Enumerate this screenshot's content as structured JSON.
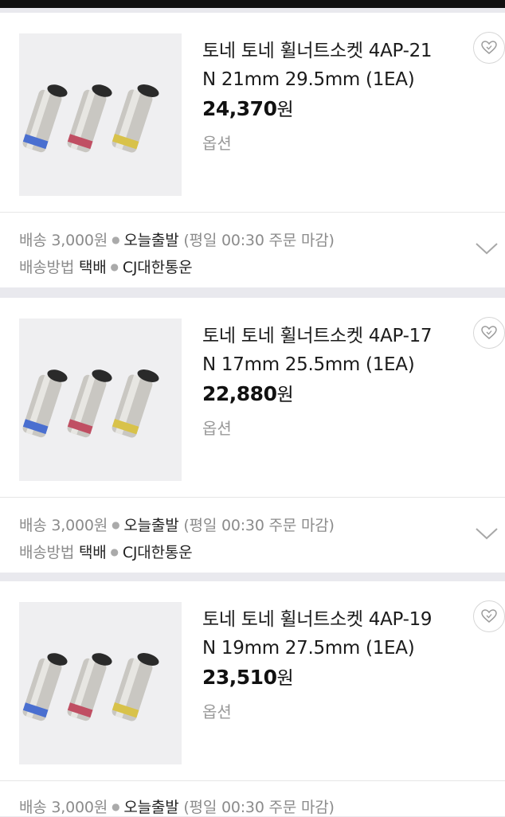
{
  "products": [
    {
      "title_line1": "토네 토네 휠너트소켓 4AP-21",
      "title_line2": "N 21mm 29.5mm (1EA)",
      "price": "24,370",
      "currency": "원",
      "option_label": "옵션",
      "shipping": {
        "fee_label": "배송",
        "fee": "3,000원",
        "dispatch": "오늘출발",
        "cutoff": "(평일 00:30 주문 마감)",
        "method_label": "배송방법",
        "method": "택배",
        "carrier": "CJ대한통운"
      }
    },
    {
      "title_line1": "토네 토네 휠너트소켓 4AP-17",
      "title_line2": "N 17mm 25.5mm (1EA)",
      "price": "22,880",
      "currency": "원",
      "option_label": "옵션",
      "shipping": {
        "fee_label": "배송",
        "fee": "3,000원",
        "dispatch": "오늘출발",
        "cutoff": "(평일 00:30 주문 마감)",
        "method_label": "배송방법",
        "method": "택배",
        "carrier": "CJ대한통운"
      }
    },
    {
      "title_line1": "토네 토네 휠너트소켓 4AP-19",
      "title_line2": "N 19mm 27.5mm (1EA)",
      "price": "23,510",
      "currency": "원",
      "option_label": "옵션",
      "shipping": {
        "fee_label": "배송",
        "fee": "3,000원",
        "dispatch": "오늘출발",
        "cutoff": "(평일 00:30 주문 마감)"
      }
    }
  ],
  "icons": {
    "wishlist": "heart-icon",
    "expand": "chevron-down-icon"
  },
  "colors": {
    "socket_band_blue": "#4a6fd0",
    "socket_band_red": "#c04f63",
    "socket_band_yellow": "#d8c24a",
    "muted_text": "#8b8b8b"
  }
}
